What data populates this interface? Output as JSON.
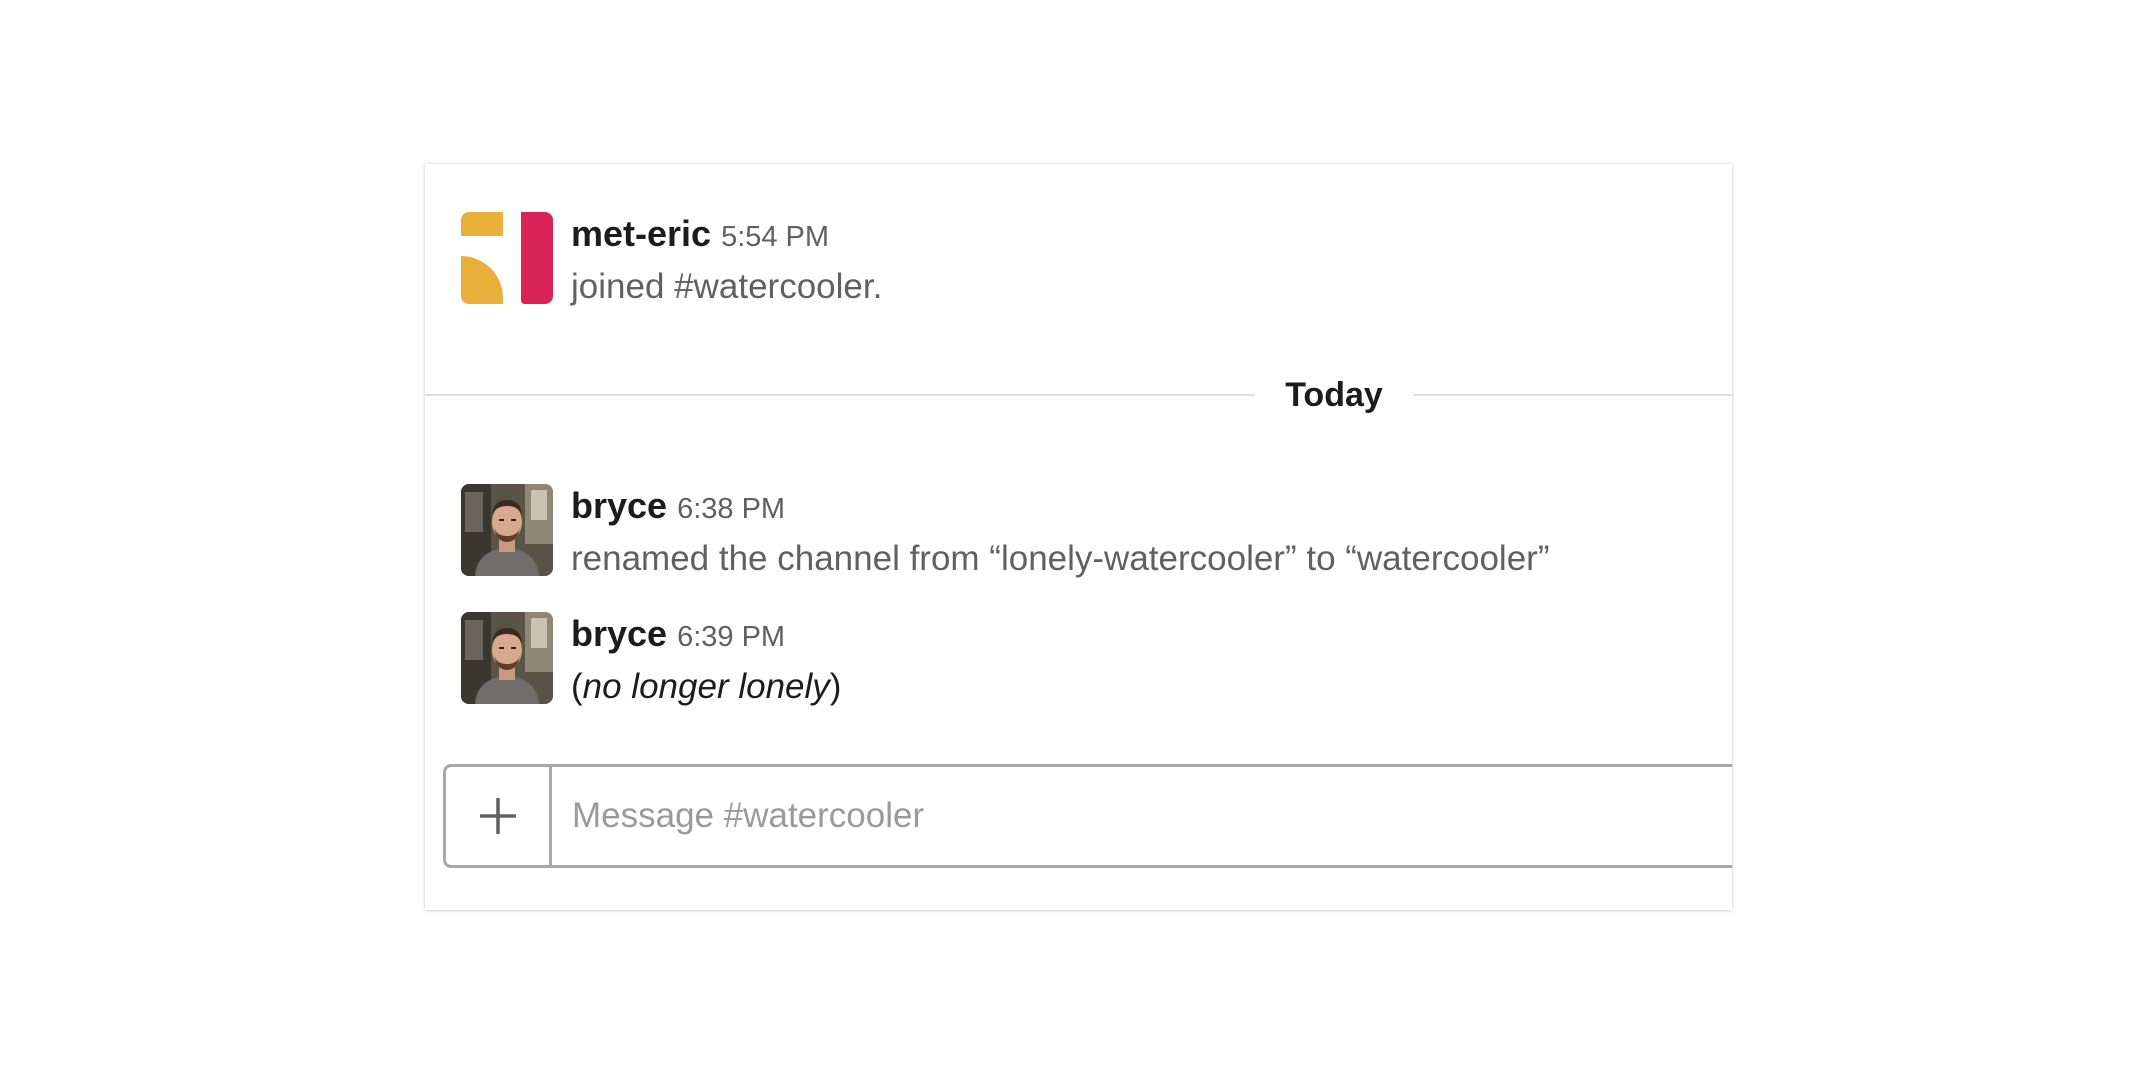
{
  "messages": [
    {
      "sender": "met-eric",
      "time": "5:54 PM",
      "text": "joined #watercooler.",
      "avatar_icon": "met-eric-logo-icon",
      "avatar_colors": [
        "#e8b03a",
        "#d72358"
      ]
    },
    {
      "sender": "bryce",
      "time": "6:38 PM",
      "text": "renamed the channel from “lonely-watercooler” to “watercooler”",
      "avatar_icon": "user-photo-avatar"
    },
    {
      "sender": "bryce",
      "time": "6:39 PM",
      "text_open": "(",
      "text_italic": "no longer lonely",
      "text_close": ")",
      "avatar_icon": "user-photo-avatar"
    }
  ],
  "divider": {
    "label": "Today"
  },
  "composer": {
    "placeholder": "Message #watercooler",
    "value": "",
    "plus_icon": "plus-icon"
  }
}
